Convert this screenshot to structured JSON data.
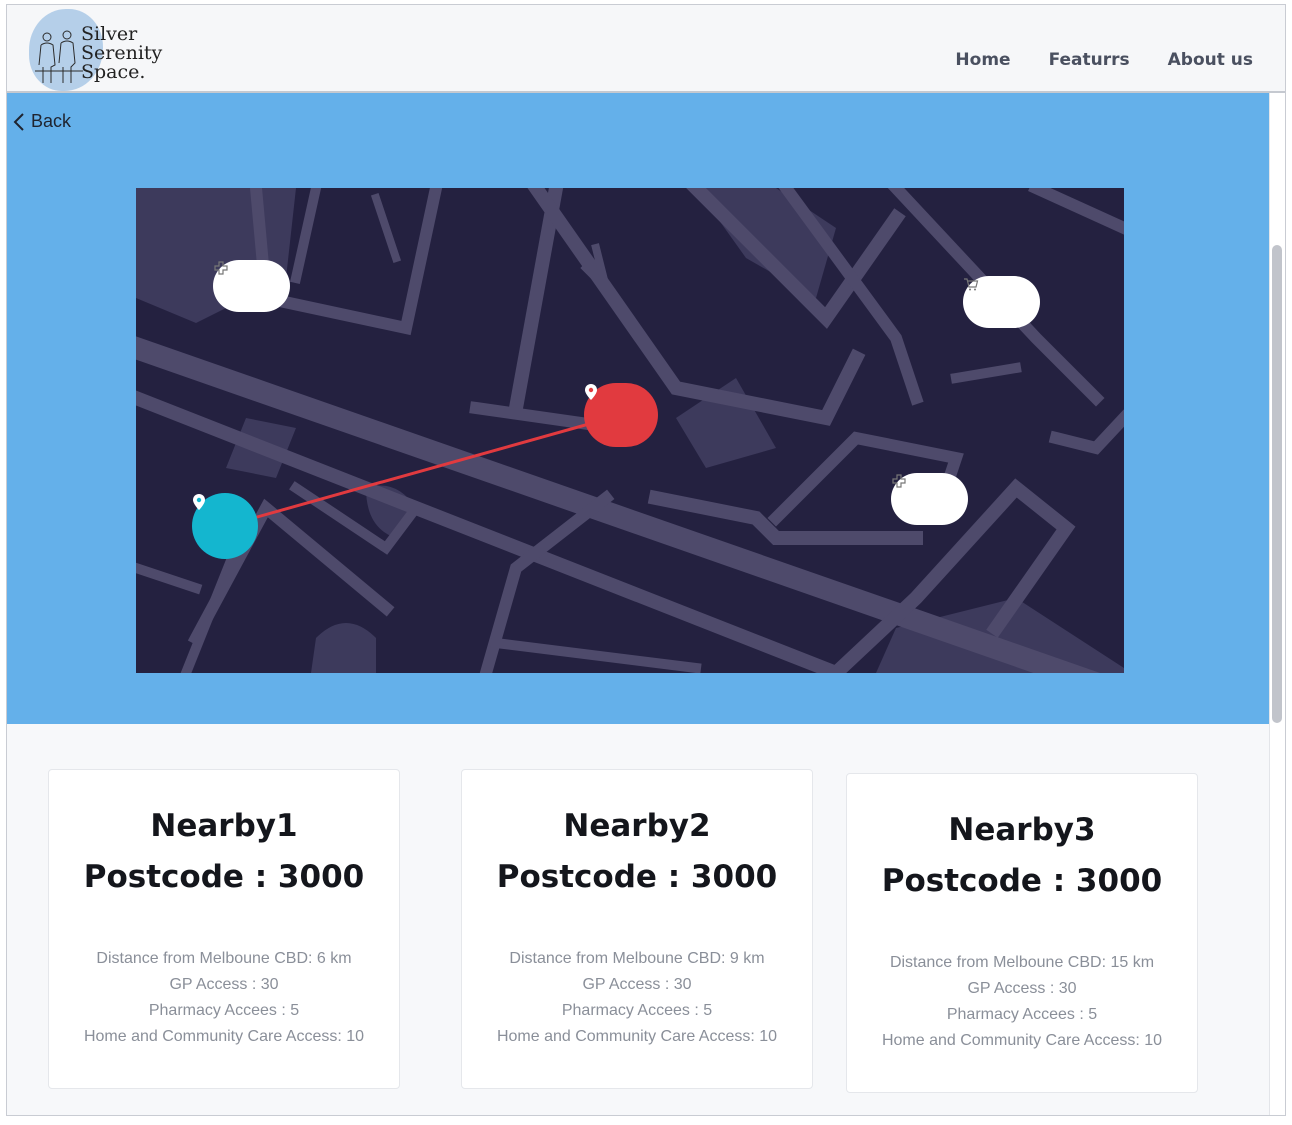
{
  "header": {
    "logo_lines": [
      "Silver",
      "Serenity",
      "Space."
    ],
    "nav": [
      "Home",
      "Featurrs",
      "About us"
    ]
  },
  "hero": {
    "back_label": "Back",
    "map": {
      "markers": [
        {
          "type": "pharmacy",
          "icon": "medical-cross-icon"
        },
        {
          "type": "shop",
          "icon": "cart-icon"
        },
        {
          "type": "pharmacy",
          "icon": "medical-cross-icon"
        },
        {
          "type": "destination",
          "icon": "location-pin-icon",
          "color": "#e13a3f"
        },
        {
          "type": "origin",
          "icon": "location-pin-icon",
          "color": "#14b6cf"
        }
      ],
      "route_color": "#e13a3f"
    }
  },
  "cards": [
    {
      "title": "Nearby1",
      "postcode": "Postcode : 3000",
      "distance": "Distance from Melboune CBD: 6 km",
      "gp": "GP Access :  30",
      "pharmacy": "Pharmacy Accees : 5",
      "care": "Home and Community Care Access: 10"
    },
    {
      "title": "Nearby2",
      "postcode": "Postcode : 3000",
      "distance": "Distance from Melboune CBD: 9 km",
      "gp": "GP Access :  30",
      "pharmacy": "Pharmacy Accees : 5",
      "care": "Home and Community Care Access: 10"
    },
    {
      "title": "Nearby3",
      "postcode": "Postcode : 3000",
      "distance": "Distance from Melboune CBD: 15 km",
      "gp": "GP Access :  30",
      "pharmacy": "Pharmacy Accees : 5",
      "care": "Home and Community Care Access: 10"
    }
  ],
  "colors": {
    "hero_bg": "#64b0ea",
    "map_bg": "#242140",
    "road": "#4e4a6b"
  }
}
